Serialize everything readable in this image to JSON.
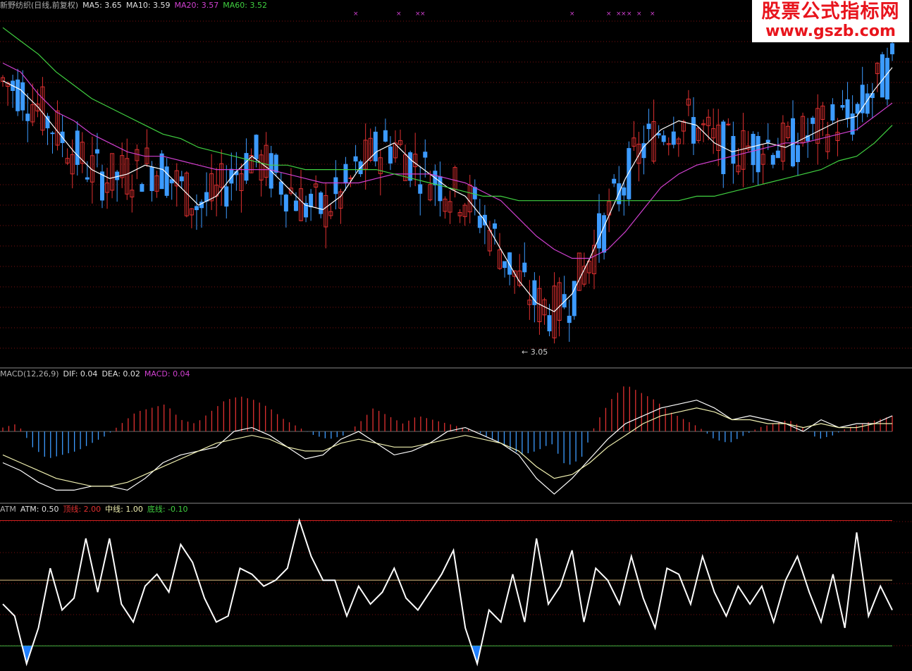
{
  "price_header": {
    "name": "新野纺织(日线,前复权)",
    "ma5": "MA5: 3.65",
    "ma10": "MA10: 3.59",
    "ma20": "MA20: 3.57",
    "ma60": "MA60: 3.52"
  },
  "macd_header": {
    "name": "MACD(12,26,9)",
    "dif": "DIF: 0.04",
    "dea": "DEA: 0.02",
    "macd": "MACD: 0.04"
  },
  "atm_header": {
    "name": "ATM",
    "atm": "ATM: 0.50",
    "top": "顶线: 2.00",
    "mid": "中线: 1.00",
    "bottom": "底线: -0.10"
  },
  "watermark": {
    "line1": "股票公式指标网",
    "line2": "www.gszb.com"
  },
  "colors": {
    "up": "#e03030",
    "down": "#3c9bff",
    "ma5": "#ffffff",
    "ma10": "#f0f0b0",
    "ma20": "#d040d0",
    "ma60": "#40d040",
    "atm_line": "#ffffff",
    "top_line": "#d02020",
    "mid_line": "#e0c080",
    "bottom_line": "#40b040",
    "fill_low": "#2080ff"
  },
  "chart_data": [
    {
      "type": "line",
      "panel": "price",
      "low_label": "3.05",
      "series": [
        {
          "name": "MA5",
          "values": [
            3.62,
            3.6,
            3.56,
            3.51,
            3.46,
            3.42,
            3.4,
            3.41,
            3.43,
            3.42,
            3.38,
            3.34,
            3.36,
            3.41,
            3.45,
            3.42,
            3.38,
            3.34,
            3.33,
            3.36,
            3.42,
            3.46,
            3.48,
            3.44,
            3.41,
            3.38,
            3.36,
            3.31,
            3.24,
            3.17,
            3.12,
            3.1,
            3.14,
            3.22,
            3.31,
            3.4,
            3.47,
            3.51,
            3.53,
            3.52,
            3.48,
            3.46,
            3.47,
            3.48,
            3.47,
            3.49,
            3.51,
            3.53,
            3.54,
            3.6,
            3.65
          ]
        },
        {
          "name": "MA20",
          "values": [
            3.66,
            3.64,
            3.59,
            3.55,
            3.53,
            3.5,
            3.48,
            3.46,
            3.45,
            3.45,
            3.44,
            3.43,
            3.42,
            3.42,
            3.42,
            3.42,
            3.41,
            3.4,
            3.39,
            3.39,
            3.39,
            3.4,
            3.41,
            3.41,
            3.41,
            3.4,
            3.39,
            3.37,
            3.35,
            3.31,
            3.27,
            3.24,
            3.22,
            3.22,
            3.24,
            3.28,
            3.33,
            3.38,
            3.41,
            3.43,
            3.44,
            3.45,
            3.46,
            3.47,
            3.48,
            3.48,
            3.49,
            3.5,
            3.51,
            3.54,
            3.57
          ]
        },
        {
          "name": "MA60",
          "values": [
            3.74,
            3.71,
            3.68,
            3.64,
            3.61,
            3.58,
            3.56,
            3.54,
            3.52,
            3.5,
            3.49,
            3.47,
            3.46,
            3.45,
            3.44,
            3.43,
            3.43,
            3.42,
            3.42,
            3.42,
            3.42,
            3.42,
            3.41,
            3.4,
            3.39,
            3.38,
            3.37,
            3.36,
            3.36,
            3.35,
            3.35,
            3.35,
            3.35,
            3.35,
            3.35,
            3.35,
            3.35,
            3.35,
            3.35,
            3.36,
            3.36,
            3.37,
            3.38,
            3.39,
            3.4,
            3.41,
            3.42,
            3.44,
            3.45,
            3.48,
            3.52
          ]
        }
      ],
      "ylim": [
        3.0,
        3.78
      ]
    },
    {
      "type": "bar",
      "panel": "macd",
      "series": [
        {
          "name": "MACD",
          "values": [
            0.01,
            0.02,
            -0.04,
            -0.07,
            -0.06,
            -0.05,
            -0.03,
            -0.01,
            0.02,
            0.05,
            0.06,
            0.07,
            0.03,
            0.02,
            0.05,
            0.08,
            0.09,
            0.08,
            0.06,
            0.03,
            0.01,
            -0.01,
            -0.02,
            -0.01,
            0.02,
            0.06,
            0.04,
            0.02,
            0.04,
            0.03,
            0.02,
            0.01,
            0.0,
            -0.02,
            -0.04,
            -0.06,
            -0.05,
            -0.03,
            -0.09,
            -0.07,
            0.02,
            0.08,
            0.12,
            0.1,
            0.08,
            0.05,
            0.03,
            0.01,
            -0.02,
            -0.03,
            -0.01,
            0.01,
            0.02,
            0.03,
            0.01,
            -0.02,
            -0.01,
            0.01,
            0.02,
            0.03,
            0.04
          ]
        },
        {
          "name": "DIF",
          "values": [
            -0.08,
            -0.1,
            -0.13,
            -0.15,
            -0.15,
            -0.14,
            -0.14,
            -0.15,
            -0.12,
            -0.08,
            -0.06,
            -0.05,
            -0.04,
            0.0,
            0.01,
            -0.01,
            -0.04,
            -0.07,
            -0.06,
            -0.02,
            0.0,
            -0.03,
            -0.06,
            -0.05,
            -0.03,
            0.0,
            0.01,
            -0.01,
            -0.03,
            -0.06,
            -0.12,
            -0.16,
            -0.12,
            -0.07,
            -0.02,
            0.02,
            0.04,
            0.06,
            0.07,
            0.08,
            0.06,
            0.03,
            0.04,
            0.03,
            0.02,
            0.0,
            0.03,
            0.01,
            0.02,
            0.02,
            0.04
          ]
        },
        {
          "name": "DEA",
          "values": [
            -0.06,
            -0.08,
            -0.1,
            -0.12,
            -0.13,
            -0.14,
            -0.14,
            -0.13,
            -0.11,
            -0.09,
            -0.07,
            -0.05,
            -0.03,
            -0.02,
            -0.01,
            -0.02,
            -0.04,
            -0.05,
            -0.05,
            -0.03,
            -0.02,
            -0.03,
            -0.04,
            -0.04,
            -0.03,
            -0.02,
            -0.01,
            -0.02,
            -0.03,
            -0.05,
            -0.09,
            -0.12,
            -0.11,
            -0.08,
            -0.04,
            -0.01,
            0.02,
            0.04,
            0.05,
            0.06,
            0.05,
            0.03,
            0.03,
            0.02,
            0.02,
            0.01,
            0.02,
            0.01,
            0.01,
            0.02,
            0.02
          ]
        }
      ],
      "ylim": [
        -0.18,
        0.13
      ]
    },
    {
      "type": "line",
      "panel": "atm",
      "series": [
        {
          "name": "ATM",
          "values": [
            0.6,
            0.4,
            -0.4,
            0.2,
            1.2,
            0.5,
            0.7,
            1.7,
            0.8,
            1.7,
            0.6,
            0.3,
            0.9,
            1.1,
            0.8,
            1.6,
            1.3,
            0.7,
            0.3,
            0.4,
            1.2,
            1.1,
            0.9,
            1.0,
            1.2,
            2.0,
            1.4,
            1.0,
            1.0,
            0.4,
            0.9,
            0.6,
            0.8,
            1.2,
            0.7,
            0.5,
            0.8,
            1.1,
            1.5,
            0.2,
            -0.4,
            0.5,
            0.3,
            1.1,
            0.3,
            1.7,
            0.6,
            0.9,
            1.5,
            0.3,
            1.2,
            1.0,
            0.6,
            1.4,
            0.7,
            0.2,
            1.2,
            1.1,
            0.6,
            1.4,
            0.8,
            0.4,
            0.9,
            0.6,
            0.9,
            0.3,
            1.0,
            1.4,
            0.8,
            0.3,
            1.1,
            0.2,
            1.8,
            0.4,
            0.9,
            0.5
          ]
        }
      ],
      "ylim": [
        -0.45,
        2.1
      ]
    }
  ]
}
